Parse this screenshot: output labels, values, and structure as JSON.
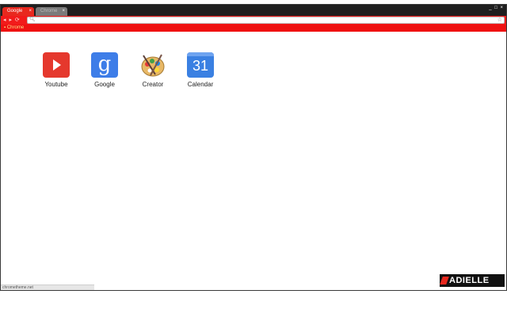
{
  "tabs": [
    {
      "label": "Google",
      "active": true
    },
    {
      "label": "Chrome",
      "active": false
    }
  ],
  "window_controls": "_ □ ×",
  "toolbar": {
    "nav_buttons": "◂ ▸ ⟳",
    "omnibox_value": "",
    "omnibox_icon": "search-icon",
    "star_icon": "star-icon"
  },
  "bookmarks": [
    {
      "label": "Chrome",
      "icon": "bookmark-icon"
    }
  ],
  "apps": [
    {
      "label": "Youtube",
      "icon": "youtube-icon"
    },
    {
      "label": "Google",
      "icon": "google-icon",
      "glyph": "g"
    },
    {
      "label": "Creator",
      "icon": "palette-icon"
    },
    {
      "label": "Calendar",
      "icon": "calendar-icon",
      "glyph": "31"
    }
  ],
  "status_text": "chrometheme.net",
  "brand_logo": "ADIELLE",
  "colors": {
    "accent": "#f21b1b",
    "titlebar": "#1f1f1f"
  }
}
